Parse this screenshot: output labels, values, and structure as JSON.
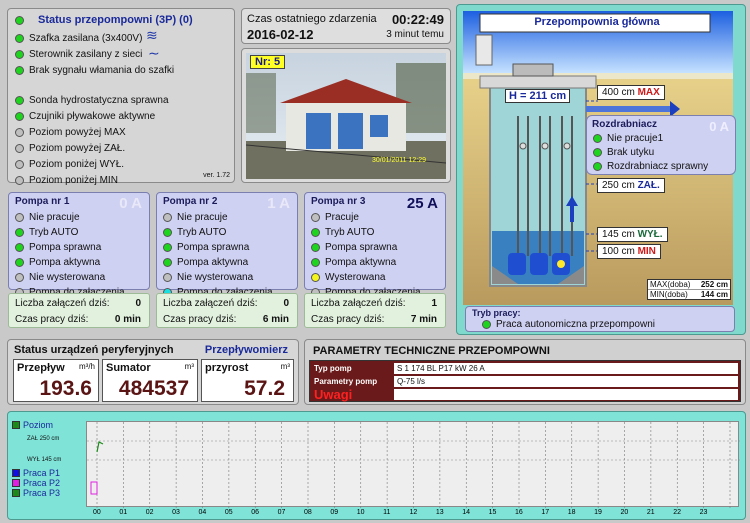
{
  "status_panel": {
    "title": "Status przepompowni (3P) (0)",
    "version": "ver. 1.72",
    "items": [
      {
        "label": "Szafka zasilana (3x400V)",
        "led": "green"
      },
      {
        "label": "Sterownik zasilany z sieci",
        "led": "green"
      },
      {
        "label": "Brak sygnału włamania do szafki",
        "led": "green"
      },
      {
        "label": "Sonda hydrostatyczna sprawna",
        "led": "green"
      },
      {
        "label": "Czujniki pływakowe aktywne",
        "led": "green"
      },
      {
        "label": "Poziom powyżej MAX",
        "led": "gray"
      },
      {
        "label": "Poziom powyżej ZAŁ.",
        "led": "gray"
      },
      {
        "label": "Poziom poniżej WYŁ.",
        "led": "gray"
      },
      {
        "label": "Poziom poniżej MIN",
        "led": "gray"
      }
    ]
  },
  "event": {
    "label": "Czas ostatniego zdarzenia",
    "time": "00:22:49",
    "date": "2016-02-12",
    "ago": "3 minut temu"
  },
  "camera": {
    "badge": "Nr: 5",
    "timestamp": "30/01/2011 12:29"
  },
  "pumps": [
    {
      "title": "Pompa nr 1",
      "amp": "0 A",
      "amp_active": false,
      "rows": [
        {
          "label": "Nie pracuje",
          "led": "gray"
        },
        {
          "label": "Tryb AUTO",
          "led": "green"
        },
        {
          "label": "Pompa sprawna",
          "led": "green"
        },
        {
          "label": "Pompa aktywna",
          "led": "green"
        },
        {
          "label": "Nie wysterowana",
          "led": "gray"
        },
        {
          "label": "Pompa do załączenia",
          "led": "gray"
        }
      ],
      "starts_label": "Liczba załączeń dziś:",
      "starts": "0",
      "runtime_label": "Czas pracy dziś:",
      "runtime": "0 min"
    },
    {
      "title": "Pompa nr 2",
      "amp": "1 A",
      "amp_active": false,
      "rows": [
        {
          "label": "Nie pracuje",
          "led": "gray"
        },
        {
          "label": "Tryb AUTO",
          "led": "green"
        },
        {
          "label": "Pompa sprawna",
          "led": "green"
        },
        {
          "label": "Pompa aktywna",
          "led": "green"
        },
        {
          "label": "Nie wysterowana",
          "led": "gray"
        },
        {
          "label": "Pompa do załączenia",
          "led": "cyan"
        }
      ],
      "starts_label": "Liczba załączeń dziś:",
      "starts": "0",
      "runtime_label": "Czas pracy dziś:",
      "runtime": "6 min"
    },
    {
      "title": "Pompa nr 3",
      "amp": "25 A",
      "amp_active": true,
      "rows": [
        {
          "label": "Pracuje",
          "led": "gray"
        },
        {
          "label": "Tryb AUTO",
          "led": "green"
        },
        {
          "label": "Pompa sprawna",
          "led": "green"
        },
        {
          "label": "Pompa aktywna",
          "led": "green"
        },
        {
          "label": "Wysterowana",
          "led": "yellow"
        },
        {
          "label": "Pompa do załączenia",
          "led": "gray"
        }
      ],
      "starts_label": "Liczba załączeń dziś:",
      "starts": "1",
      "runtime_label": "Czas pracy dziś:",
      "runtime": "7 min"
    }
  ],
  "station": {
    "title": "Przepompownia główna",
    "height": "H = 211 cm",
    "levels": {
      "max": "400 cm",
      "max_tag": "MAX",
      "zal": "250 cm",
      "zal_tag": "ZAŁ.",
      "wyl": "145 cm",
      "wyl_tag": "WYŁ.",
      "min": "100 cm",
      "min_tag": "MIN"
    },
    "shredder": {
      "title": "Rozdrabniacz",
      "amp": "0 A",
      "rows": [
        {
          "label": "Nie pracuje1",
          "led": "green"
        },
        {
          "label": "Brak utyku",
          "led": "green"
        },
        {
          "label": "Rozdrabniacz sprawny",
          "led": "green"
        }
      ]
    },
    "max_doba_label": "MAX(doba)",
    "max_doba": "252 cm",
    "min_doba_label": "MIN(doba)",
    "min_doba": "144 cm",
    "mode_title": "Tryb pracy:",
    "mode": "Praca autonomiczna przepompowni"
  },
  "peripheral": {
    "title": "Status urządzeń peryferyjnych",
    "link": "Przepływomierz",
    "flow_label": "Przepływ",
    "flow_unit": "m³/h",
    "flow": "193.6",
    "sum_label": "Sumator",
    "sum_unit": "m³",
    "sum": "484537",
    "inc_label": "przyrost",
    "inc_unit": "m³",
    "inc": "57.2"
  },
  "params": {
    "title": "PARAMETRY TECHNICZNE PRZEPOMPOWNI",
    "typ_label": "Typ pomp",
    "typ": "S 1 174 BL   P17 kW 26 A",
    "par_label": "Parametry pomp",
    "par": "Q-75 l/s",
    "uwagi": "Uwagi"
  },
  "trend": {
    "legend": [
      {
        "label": "Poziom",
        "color": "#1b8a1b"
      },
      {
        "label": "Praca P1",
        "color": "#1010e0"
      },
      {
        "label": "Praca P2",
        "color": "#e020e0"
      },
      {
        "label": "Praca P3",
        "color": "#1b8a1b"
      }
    ],
    "zal_label": "ZAŁ 250 cm",
    "wyl_label": "WYŁ 145 cm",
    "hours": [
      "00",
      "01",
      "02",
      "03",
      "04",
      "05",
      "06",
      "07",
      "08",
      "09",
      "10",
      "11",
      "12",
      "13",
      "14",
      "15",
      "16",
      "17",
      "18",
      "19",
      "20",
      "21",
      "22",
      "23"
    ]
  }
}
